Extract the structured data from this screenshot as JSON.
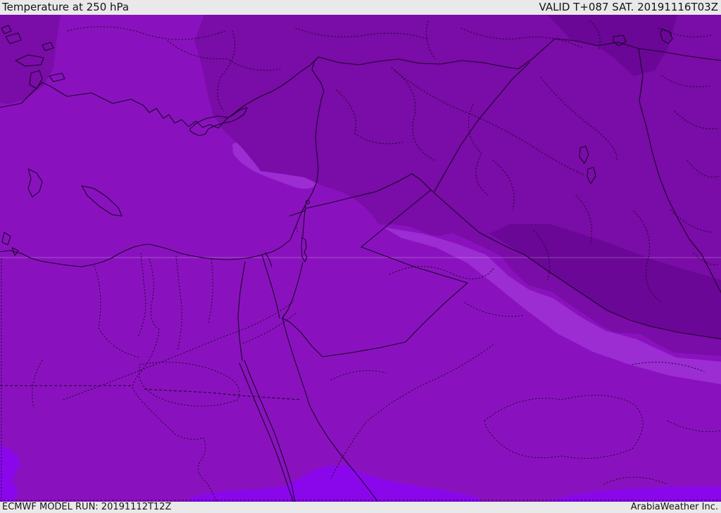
{
  "header": {
    "title": "Temperature at 250 hPa",
    "valid": "VALID T+087 SAT. 20191116T03Z"
  },
  "footer": {
    "model_run": "ECMWF MODEL RUN: 20191112T12Z",
    "credit": "ArabiaWeather Inc."
  },
  "map": {
    "palette": {
      "medium": "#8A12BE",
      "dark": "#7A0CA7",
      "darkest": "#6A0796",
      "light": "#9B2DD2",
      "bright": "#8A07EC",
      "line": "#1A0529",
      "admin": "#230736",
      "graticule": "rgba(240,220,255,0.30)",
      "bar_bg": "#E9E9E9",
      "bar_text": "#141414"
    }
  }
}
